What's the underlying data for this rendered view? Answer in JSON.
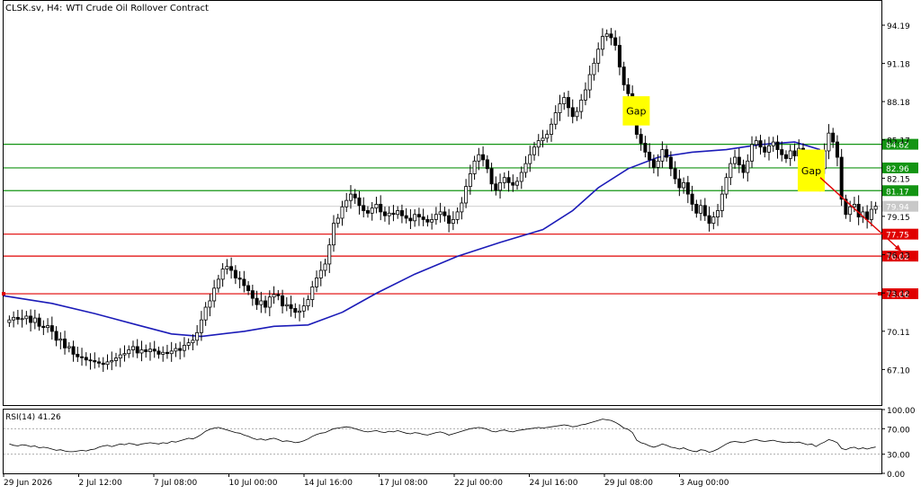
{
  "header": {
    "symbol": "CLSK.sv, H4:",
    "title": "WTI Crude Oil Rollover Contract"
  },
  "colors": {
    "background": "#ffffff",
    "frame": "#000000",
    "candle_up": "#ffffff",
    "candle_down": "#000000",
    "moving_average": "#1b1bb8",
    "support": "#e00000",
    "resistance": "#139413",
    "gap_box": "#ffff00",
    "arrow": "#e00000",
    "rsi_line": "#000000"
  },
  "chart_data": [
    {
      "type": "candlestick",
      "title": "WTI Crude Oil Rollover Contract",
      "timeframe": "H4",
      "ylim": [
        64.3,
        96.1
      ],
      "y_ticks": [
        "94.19",
        "91.18",
        "88.18",
        "85.17",
        "82.15",
        "79.15",
        "76.13",
        "73.12",
        "70.11",
        "67.10"
      ],
      "x_ticks": [
        "29 Jun 2026",
        "2 Jul 12:00",
        "7 Jul 08:00",
        "10 Jul 00:00",
        "14 Jul 16:00",
        "17 Jul 08:00",
        "22 Jul 00:00",
        "24 Jul 16:00",
        "29 Jul 08:00",
        "3 Aug 00:00"
      ],
      "last_price": "79.94",
      "horizontal_levels": [
        {
          "value": 84.82,
          "label": "84.82",
          "kind": "resistance"
        },
        {
          "value": 82.96,
          "label": "82.96",
          "kind": "resistance"
        },
        {
          "value": 81.17,
          "label": "81.17",
          "kind": "resistance"
        },
        {
          "value": 77.75,
          "label": "77.75",
          "kind": "support"
        },
        {
          "value": 76.02,
          "label": "76.02",
          "kind": "support"
        },
        {
          "value": 73.06,
          "label": "73.06",
          "kind": "support"
        }
      ],
      "annotations": [
        {
          "text": "Gap",
          "bar": 145,
          "y_top": 88.6,
          "y_bottom": 86.3
        },
        {
          "text": "Gap",
          "bar": 186,
          "y_top": 84.4,
          "y_bottom": 81.1
        }
      ],
      "arrow": {
        "from": {
          "bar": 190,
          "value": 82.2
        },
        "to": {
          "bar": 209,
          "value": 76.4
        }
      },
      "close": [
        71.0,
        71.2,
        71.05,
        71.1,
        71.3,
        70.8,
        71.15,
        70.5,
        70.4,
        70.55,
        70.1,
        69.4,
        69.5,
        68.8,
        68.9,
        68.3,
        68.1,
        68.05,
        67.85,
        67.8,
        67.7,
        67.6,
        67.5,
        67.7,
        67.8,
        68.0,
        68.25,
        68.35,
        68.65,
        68.9,
        68.4,
        68.65,
        68.5,
        68.7,
        68.55,
        68.3,
        68.45,
        68.35,
        68.55,
        68.75,
        68.6,
        69.0,
        69.2,
        69.4,
        70.0,
        71.0,
        72.0,
        72.5,
        73.5,
        74.2,
        75.0,
        75.2,
        74.9,
        74.3,
        74.2,
        73.7,
        73.3,
        72.7,
        72.2,
        72.5,
        72.0,
        72.8,
        73.0,
        72.9,
        72.1,
        72.2,
        71.9,
        71.6,
        71.7,
        72.1,
        72.6,
        73.6,
        74.3,
        74.9,
        75.4,
        76.9,
        78.6,
        79.0,
        79.9,
        80.4,
        80.9,
        80.6,
        80.0,
        79.6,
        79.4,
        79.8,
        80.1,
        79.5,
        79.2,
        79.4,
        79.3,
        79.6,
        79.2,
        79.0,
        78.8,
        79.3,
        79.1,
        78.9,
        78.7,
        78.9,
        79.3,
        79.5,
        79.2,
        78.6,
        78.9,
        79.5,
        80.2,
        81.5,
        82.5,
        83.5,
        84.0,
        83.6,
        82.9,
        81.7,
        81.2,
        81.8,
        82.2,
        81.8,
        81.6,
        81.9,
        82.6,
        83.3,
        84.0,
        84.6,
        85.1,
        85.3,
        85.6,
        86.4,
        87.3,
        88.0,
        88.5,
        87.7,
        87.0,
        87.4,
        88.3,
        89.1,
        90.3,
        91.2,
        92.3,
        93.3,
        93.5,
        93.2,
        92.6,
        90.9,
        89.5,
        88.8,
        87.8,
        85.6,
        84.9,
        84.2,
        83.6,
        83.0,
        83.5,
        84.4,
        83.8,
        82.9,
        82.1,
        81.4,
        81.8,
        80.9,
        80.1,
        79.4,
        80.0,
        79.2,
        78.6,
        79.1,
        79.6,
        80.9,
        82.2,
        83.3,
        83.8,
        83.2,
        82.6,
        83.5,
        84.8,
        85.1,
        84.6,
        84.2,
        84.7,
        85.0,
        84.4,
        84.0,
        83.7,
        84.3,
        83.9,
        84.5,
        83.6,
        82.8,
        83.4,
        81.7,
        82.9,
        84.3,
        85.7,
        85.0,
        83.8,
        80.5,
        79.3,
        79.9,
        80.1,
        79.1,
        79.5,
        78.9,
        79.7,
        79.94
      ],
      "moving_average": [
        {
          "bar": 0,
          "value": 72.9
        },
        {
          "bar": 10,
          "value": 72.3
        },
        {
          "bar": 20,
          "value": 71.5
        },
        {
          "bar": 30,
          "value": 70.6
        },
        {
          "bar": 38,
          "value": 69.9
        },
        {
          "bar": 45,
          "value": 69.7
        },
        {
          "bar": 55,
          "value": 70.1
        },
        {
          "bar": 62,
          "value": 70.5
        },
        {
          "bar": 70,
          "value": 70.6
        },
        {
          "bar": 78,
          "value": 71.6
        },
        {
          "bar": 86,
          "value": 73.1
        },
        {
          "bar": 95,
          "value": 74.6
        },
        {
          "bar": 105,
          "value": 76.0
        },
        {
          "bar": 115,
          "value": 77.1
        },
        {
          "bar": 125,
          "value": 78.1
        },
        {
          "bar": 132,
          "value": 79.6
        },
        {
          "bar": 138,
          "value": 81.4
        },
        {
          "bar": 145,
          "value": 82.9
        },
        {
          "bar": 152,
          "value": 83.8
        },
        {
          "bar": 160,
          "value": 84.2
        },
        {
          "bar": 168,
          "value": 84.4
        },
        {
          "bar": 176,
          "value": 84.8
        },
        {
          "bar": 184,
          "value": 85.0
        },
        {
          "bar": 190,
          "value": 84.4
        }
      ]
    },
    {
      "type": "line",
      "title": "RSI(14) 41.26",
      "ylim": [
        0,
        100
      ],
      "y_ticks": [
        "100.00",
        "70.00",
        "30.00",
        "0.00"
      ],
      "levels": [
        70,
        30
      ],
      "values": [
        46,
        44,
        43,
        45,
        44,
        42,
        43,
        40,
        41,
        40,
        38,
        36,
        37,
        35,
        34,
        34,
        35,
        36,
        35,
        37,
        38,
        41,
        43,
        44,
        42,
        44,
        46,
        45,
        47,
        46,
        44,
        46,
        47,
        48,
        47,
        46,
        48,
        47,
        50,
        49,
        51,
        53,
        55,
        54,
        57,
        61,
        66,
        69,
        71,
        72,
        70,
        68,
        66,
        64,
        63,
        60,
        58,
        55,
        53,
        54,
        52,
        54,
        55,
        53,
        50,
        51,
        50,
        48,
        49,
        51,
        54,
        58,
        61,
        63,
        64,
        67,
        70,
        71,
        72,
        73,
        72,
        70,
        68,
        66,
        65,
        66,
        67,
        65,
        64,
        66,
        65,
        67,
        65,
        63,
        62,
        64,
        63,
        61,
        60,
        62,
        64,
        65,
        63,
        60,
        62,
        64,
        66,
        68,
        70,
        71,
        72,
        71,
        69,
        66,
        65,
        67,
        68,
        66,
        65,
        67,
        68,
        69,
        70,
        71,
        72,
        71,
        72,
        73,
        74,
        75,
        76,
        75,
        73,
        74,
        76,
        77,
        79,
        81,
        83,
        85,
        84,
        83,
        80,
        76,
        71,
        69,
        64,
        52,
        48,
        46,
        43,
        41,
        43,
        46,
        44,
        41,
        40,
        38,
        40,
        37,
        35,
        34,
        37,
        36,
        33,
        35,
        38,
        42,
        46,
        49,
        50,
        49,
        48,
        50,
        52,
        53,
        51,
        50,
        51,
        52,
        50,
        49,
        48,
        49,
        48,
        49,
        47,
        45,
        46,
        42,
        46,
        49,
        53,
        51,
        48,
        39,
        37,
        40,
        41,
        38,
        40,
        38,
        40,
        41.26
      ]
    }
  ]
}
